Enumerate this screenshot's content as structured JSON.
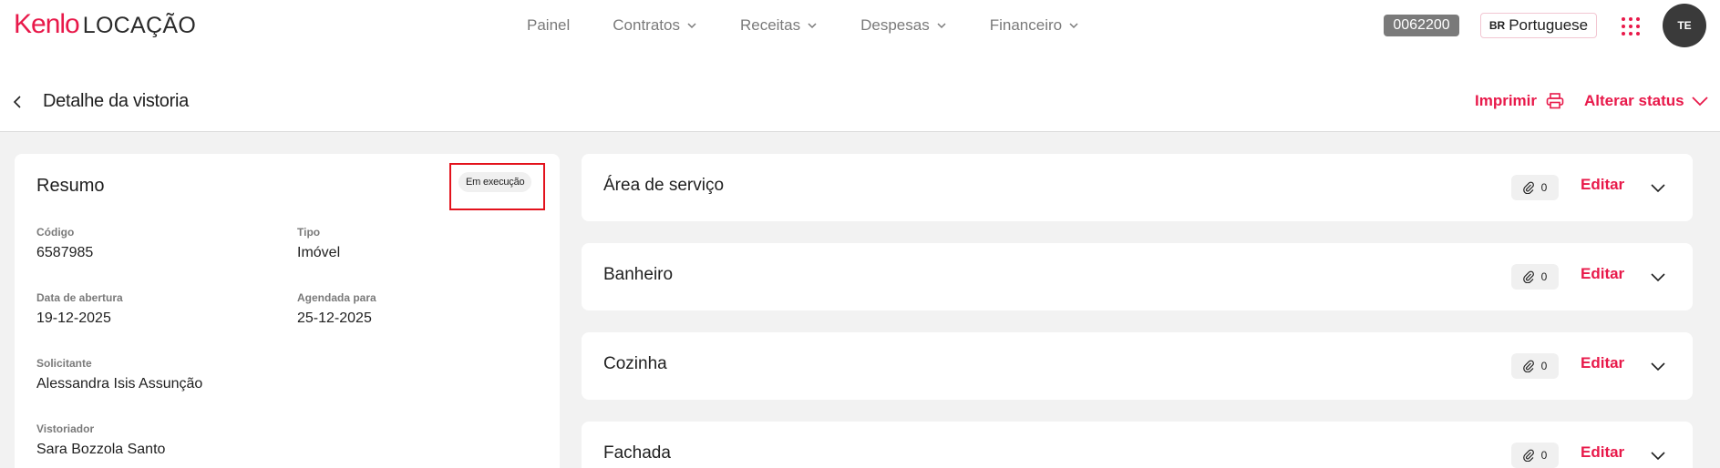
{
  "logo": {
    "brand": "Kenlo",
    "product": "LOCAÇÃO"
  },
  "nav": {
    "items": [
      {
        "label": "Painel",
        "has_dropdown": false
      },
      {
        "label": "Contratos",
        "has_dropdown": true
      },
      {
        "label": "Receitas",
        "has_dropdown": true
      },
      {
        "label": "Despesas",
        "has_dropdown": true
      },
      {
        "label": "Financeiro",
        "has_dropdown": true
      }
    ],
    "account_code": "0062200",
    "language_flag": "BR",
    "language_label": "Portuguese",
    "avatar_initials": "TE"
  },
  "header": {
    "title": "Detalhe da vistoria",
    "print_label": "Imprimir",
    "status_label": "Alterar status"
  },
  "summary": {
    "title": "Resumo",
    "status": "Em execução",
    "fields": {
      "codigo": {
        "label": "Código",
        "value": "6587985"
      },
      "tipo": {
        "label": "Tipo",
        "value": "Imóvel"
      },
      "data_abertura": {
        "label": "Data de abertura",
        "value": "19-12-2025"
      },
      "agendada_para": {
        "label": "Agendada para",
        "value": "25-12-2025"
      },
      "solicitante": {
        "label": "Solicitante",
        "value": "Alessandra Isis Assunção"
      },
      "vistoriador": {
        "label": "Vistoriador",
        "value": "Sara Bozzola Santo"
      }
    }
  },
  "sections": [
    {
      "title": "Área de serviço",
      "attachments": "0",
      "edit_label": "Editar"
    },
    {
      "title": "Banheiro",
      "attachments": "0",
      "edit_label": "Editar"
    },
    {
      "title": "Cozinha",
      "attachments": "0",
      "edit_label": "Editar"
    },
    {
      "title": "Fachada",
      "attachments": "0",
      "edit_label": "Editar"
    }
  ],
  "colors": {
    "accent": "#e8194a",
    "highlight_box": "#e3121c",
    "background": "#f2f2f2"
  }
}
